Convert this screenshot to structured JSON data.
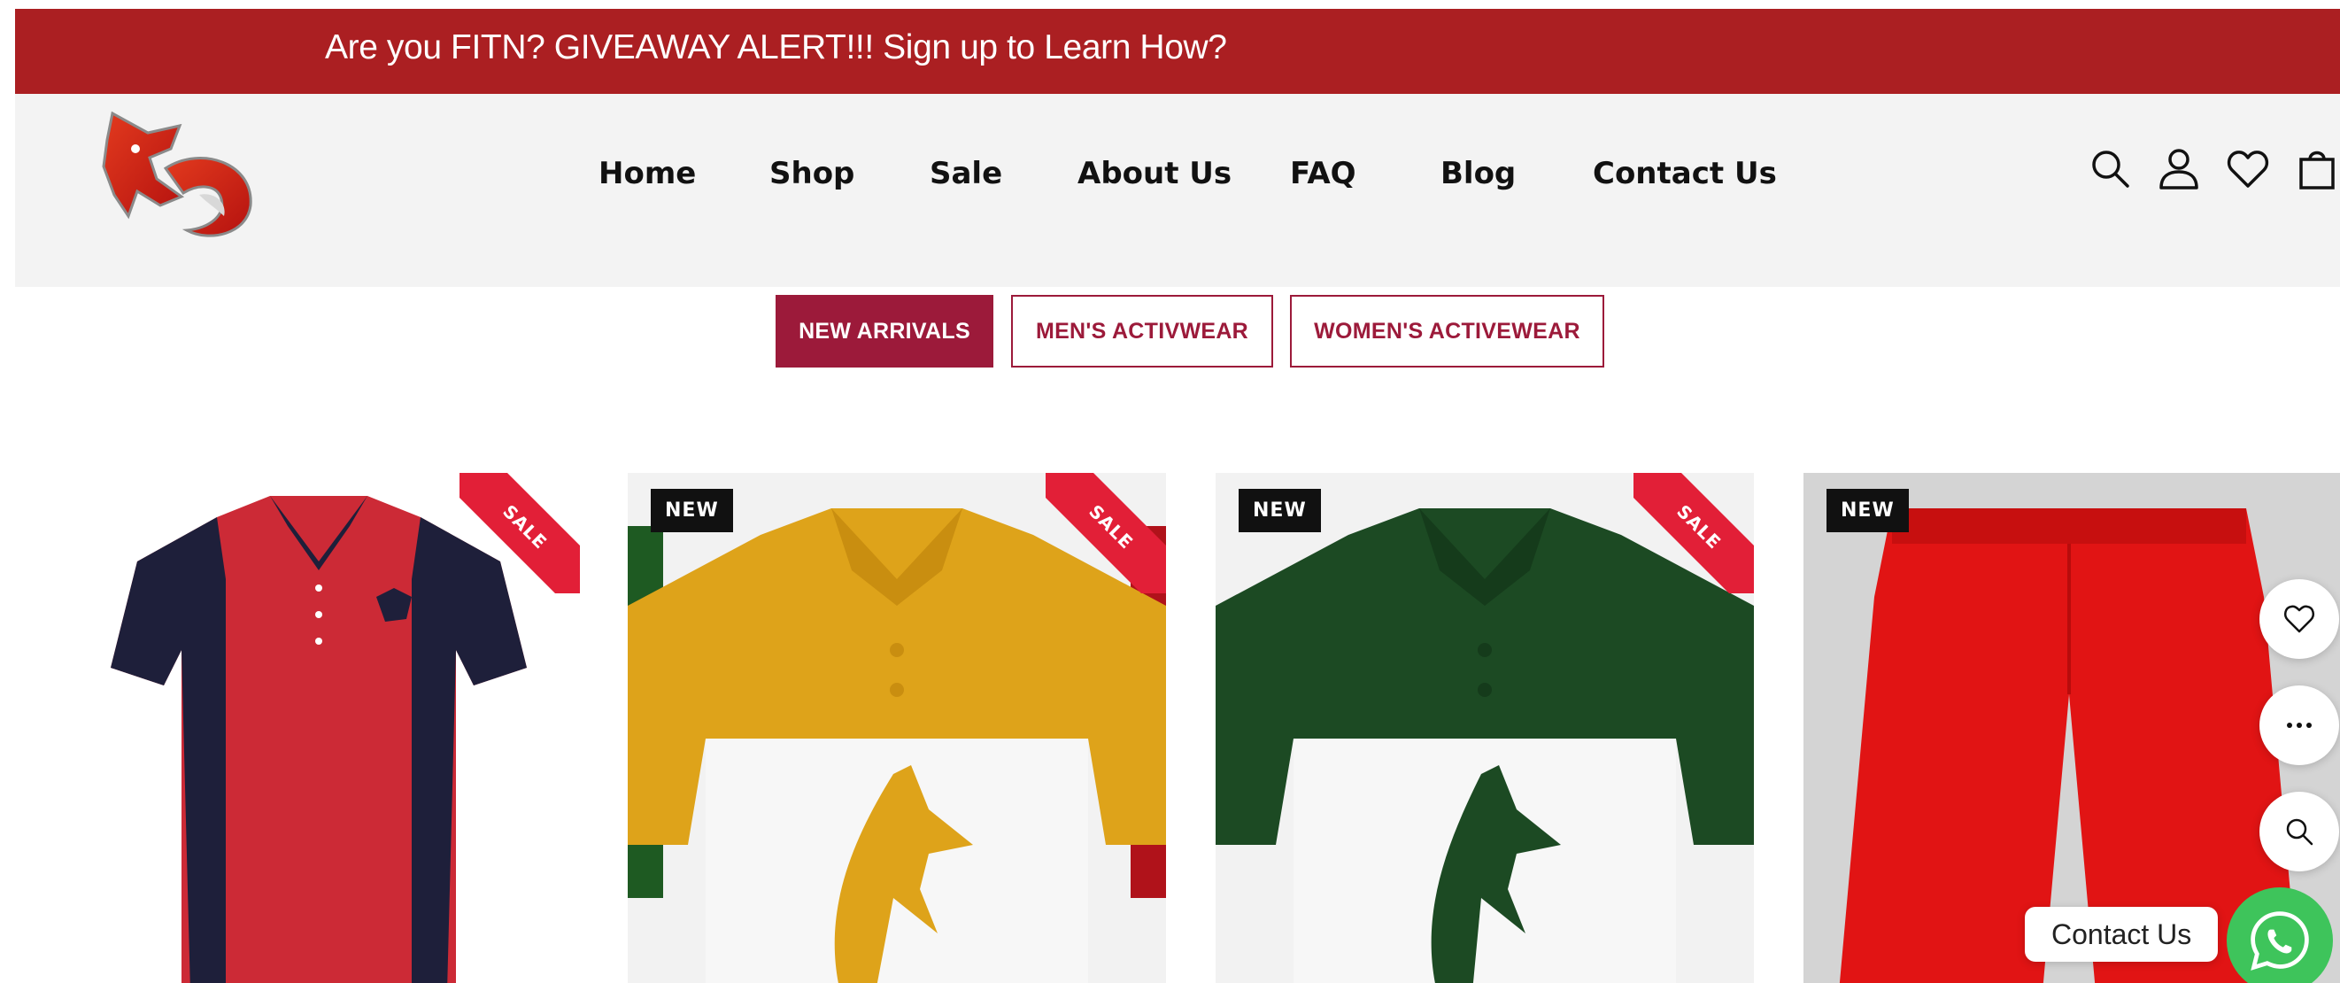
{
  "announcement": {
    "text": "Are you FITN? GIVEAWAY ALERT!!! Sign up to Learn How?"
  },
  "nav": {
    "items": [
      {
        "label": "Home"
      },
      {
        "label": "Shop"
      },
      {
        "label": "Sale"
      },
      {
        "label": "About Us"
      },
      {
        "label": "FAQ"
      },
      {
        "label": "Blog"
      },
      {
        "label": "Contact Us"
      }
    ]
  },
  "header_icons": [
    "search-icon",
    "account-icon",
    "wishlist-heart-icon",
    "shopping-bag-icon"
  ],
  "category_tabs": [
    {
      "label": "NEW ARRIVALS",
      "active": true
    },
    {
      "label": "MEN'S ACTIVWEAR",
      "active": false
    },
    {
      "label": "WOMEN'S ACTIVEWEAR",
      "active": false
    }
  ],
  "products": [
    {
      "badge_new": "",
      "ribbon": "SALE",
      "product": "red and navy polo shirt"
    },
    {
      "badge_new": "NEW",
      "ribbon": "SALE",
      "product": "yellow and white polo shirt"
    },
    {
      "badge_new": "NEW",
      "ribbon": "SALE",
      "product": "green and white polo shirt"
    },
    {
      "badge_new": "NEW",
      "ribbon": "",
      "product": "red shorts"
    }
  ],
  "floating_actions": [
    "wishlist-heart-icon",
    "more-options-icon",
    "quick-view-search-icon"
  ],
  "contact": {
    "label": "Contact Us"
  },
  "colors": {
    "announcement_bg": "#ab1f22",
    "header_bg": "#f3f3f3",
    "tab_accent": "#9c1a3a",
    "sale_ribbon": "#e21f37",
    "whatsapp": "#3ec45b"
  }
}
